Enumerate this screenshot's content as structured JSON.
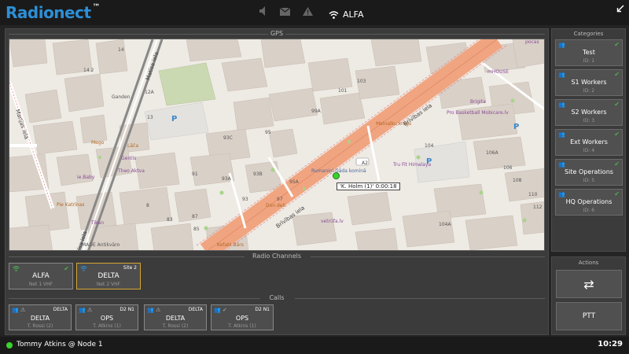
{
  "app": {
    "logo_text": "Radionect",
    "logo_tm": "™",
    "active_network": "ALFA"
  },
  "top_icons": [
    "speaker-muted-icon",
    "message-icon",
    "warning-icon",
    "wifi-icon"
  ],
  "sections": {
    "gps": "GPS",
    "radio_channels": "Radio Channels",
    "calls": "Calls",
    "categories": "Categories",
    "actions": "Actions"
  },
  "map": {
    "marker_label": "'K. Holm (1)' 0:00:18",
    "streets": [
      "Brīvības iela",
      "Brīvības iela",
      "Matīsa iela",
      "Matīsa iela",
      "Marijas iela"
    ],
    "road_badge": "A2",
    "pois": [
      {
        "text": "Ganden",
        "kind": "normal"
      },
      {
        "text": "Mego",
        "kind": "orange"
      },
      {
        "text": "Lāča",
        "kind": "orange"
      },
      {
        "text": "Gentis",
        "kind": "purple"
      },
      {
        "text": "Theo Aktva",
        "kind": "purple"
      },
      {
        "text": "ie.Baby",
        "kind": "purple"
      },
      {
        "text": "Pie Katrīnas",
        "kind": "orange"
      },
      {
        "text": "Tikan",
        "kind": "purple"
      },
      {
        "text": "MADE Antikvāro",
        "kind": "normal"
      },
      {
        "text": "Kefabi Bārs",
        "kind": "orange"
      },
      {
        "text": "Don deli",
        "kind": "orange"
      },
      {
        "text": "Rumaniņi Gāda kominā",
        "kind": "blue"
      },
      {
        "text": "Melnalku krogs",
        "kind": "orange"
      },
      {
        "text": "Brigita",
        "kind": "purple"
      },
      {
        "text": "Pro Basketball Mobicare.lv",
        "kind": "purple"
      },
      {
        "text": "Tru Fit Himalaya",
        "kind": "purple"
      },
      {
        "text": "vetrūfa.lv",
        "kind": "purple"
      },
      {
        "text": "mHOUSE",
        "kind": "purple"
      },
      {
        "text": "pocas",
        "kind": "purple"
      }
    ],
    "house_numbers": [
      "14",
      "14 2",
      "12A",
      "13",
      "93C",
      "95",
      "99A",
      "101",
      "103",
      "104",
      "106A",
      "106",
      "108",
      "110",
      "112",
      "93B",
      "93A",
      "93",
      "91",
      "95A",
      "97",
      "85",
      "87",
      "83",
      "8",
      "104A"
    ]
  },
  "radio_channels": [
    {
      "name": "ALFA",
      "sub": "Net 1 VHF",
      "status": "connected",
      "tag": "",
      "selected": false
    },
    {
      "name": "DELTA",
      "sub": "Net 2 VHF",
      "status": "",
      "tag": "Site 2",
      "selected": true
    }
  ],
  "calls": [
    {
      "tag": "DELTA",
      "name": "DELTA",
      "sub": "T. Rossi (2)",
      "status": "warning"
    },
    {
      "tag": "D2 N1",
      "name": "OPS",
      "sub": "T. Atkins (1)",
      "status": "warning"
    },
    {
      "tag": "DELTA",
      "name": "DELTA",
      "sub": "T. Rossi (2)",
      "status": "warning"
    },
    {
      "tag": "D2 N1",
      "name": "OPS",
      "sub": "T. Atkins (1)",
      "status": "ok"
    }
  ],
  "categories": [
    {
      "name": "Test",
      "id": "ID: 1"
    },
    {
      "name": "S1 Workers",
      "id": "ID: 2"
    },
    {
      "name": "S2 Workers",
      "id": "ID: 3"
    },
    {
      "name": "Ext Workers",
      "id": "ID: 4"
    },
    {
      "name": "Site Operations",
      "id": "ID: 5"
    },
    {
      "name": "HQ Operations",
      "id": "ID: 6"
    }
  ],
  "actions": {
    "swap_glyph": "⇄",
    "ptt_label": "PTT"
  },
  "status": {
    "user": "Tommy Atkins @ Node 1",
    "time": "10:29",
    "online_color": "#3bd12f"
  },
  "colors": {
    "accent": "#2d8fd6",
    "selected_border": "#d4a630",
    "ok": "#4caf50",
    "main_road": "#f0a580"
  }
}
